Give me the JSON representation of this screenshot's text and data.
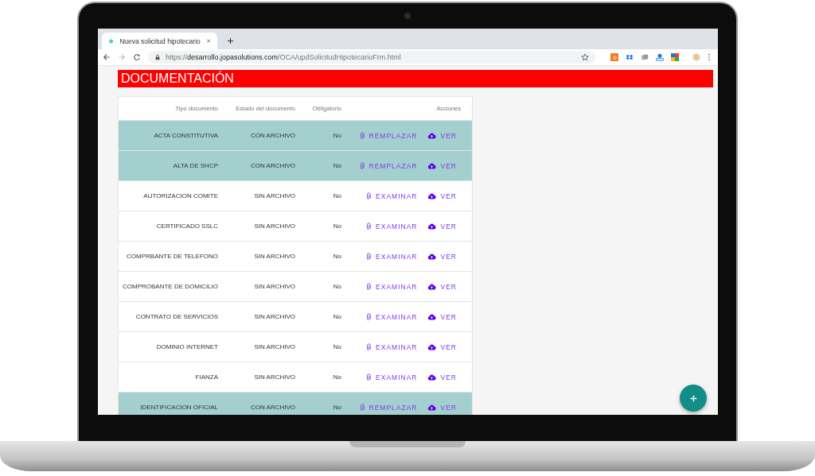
{
  "browser": {
    "tab": {
      "title": "Nueva solicitud hipotecario"
    },
    "url": "https://**desarrollo.jopasolutions.com**/OCA/updSolicitudHipotecarioFrm.html"
  },
  "section": {
    "title": "DOCUMENTACIÓN"
  },
  "table": {
    "columns": [
      "Tipo documento",
      "Estado del documento",
      "Obligatorio",
      "Acciones"
    ],
    "rows": [
      {
        "tipo": "ACTA CONSTITUTIVA",
        "estado": "CON ARCHIVO",
        "obligatorio": "No",
        "action": "REMPLAZAR",
        "view": "VER",
        "highlighted": true
      },
      {
        "tipo": "ALTA DE SHCP",
        "estado": "CON ARCHIVO",
        "obligatorio": "No",
        "action": "REMPLAZAR",
        "view": "VER",
        "highlighted": true
      },
      {
        "tipo": "AUTORIZACION COMITE",
        "estado": "SIN ARCHIVO",
        "obligatorio": "No",
        "action": "EXAMINAR",
        "view": "VER",
        "highlighted": false
      },
      {
        "tipo": "CERTIFICADO SSLC",
        "estado": "SIN ARCHIVO",
        "obligatorio": "No",
        "action": "EXAMINAR",
        "view": "VER",
        "highlighted": false
      },
      {
        "tipo": "COMPRBANTE DE TELEFONO",
        "estado": "SIN ARCHIVO",
        "obligatorio": "No",
        "action": "EXAMINAR",
        "view": "VER",
        "highlighted": false
      },
      {
        "tipo": "COMPROBANTE DE DOMICILIO",
        "estado": "SIN ARCHIVO",
        "obligatorio": "No",
        "action": "EXAMINAR",
        "view": "VER",
        "highlighted": false
      },
      {
        "tipo": "CONTRATO DE SERVICIOS",
        "estado": "SIN ARCHIVO",
        "obligatorio": "No",
        "action": "EXAMINAR",
        "view": "VER",
        "highlighted": false
      },
      {
        "tipo": "DOMINIO INTERNET",
        "estado": "SIN ARCHIVO",
        "obligatorio": "No",
        "action": "EXAMINAR",
        "view": "VER",
        "highlighted": false
      },
      {
        "tipo": "FIANZA",
        "estado": "SIN ARCHIVO",
        "obligatorio": "No",
        "action": "EXAMINAR",
        "view": "VER",
        "highlighted": false
      },
      {
        "tipo": "IDENTIFICACION OFICIAL",
        "estado": "CON ARCHIVO",
        "obligatorio": "No",
        "action": "REMPLAZAR",
        "view": "VER",
        "highlighted": true
      }
    ]
  }
}
